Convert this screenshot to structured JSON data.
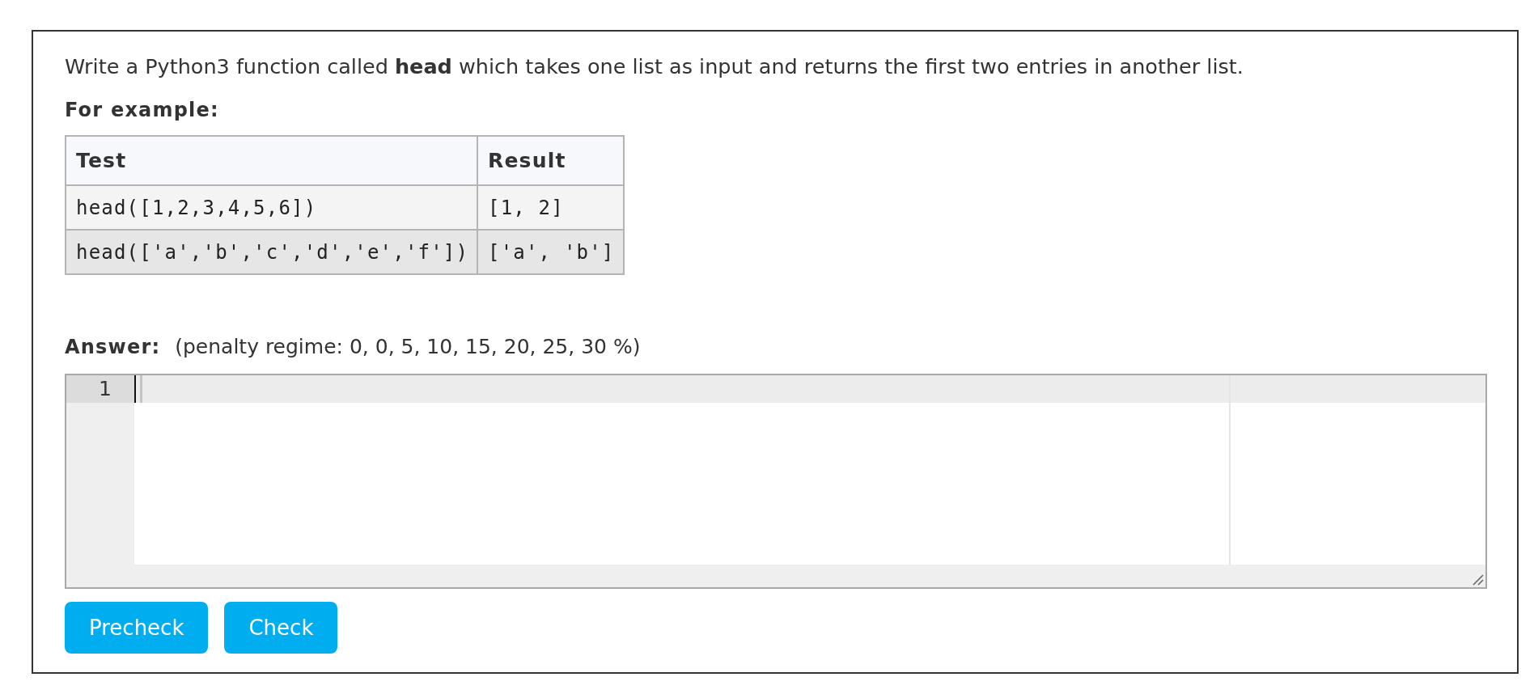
{
  "question": {
    "text": "Write a Python3 function called **head** which takes one list as input and returns the first two entries in another list."
  },
  "example_heading": "For example:",
  "examples_table": {
    "columns": [
      "Test",
      "Result"
    ],
    "rows": [
      [
        "head([1,2,3,4,5,6])",
        "[1, 2]"
      ],
      [
        "head(['a','b','c','d','e','f'])",
        "['a', 'b']"
      ]
    ]
  },
  "answer": {
    "label": "Answer:",
    "penalty_note": "(penalty regime: 0, 0, 5, 10, 15, 20, 25, 30 %)",
    "editor": {
      "line_numbers": [
        "1"
      ]
    }
  },
  "buttons": [
    "Precheck",
    "Check"
  ]
}
